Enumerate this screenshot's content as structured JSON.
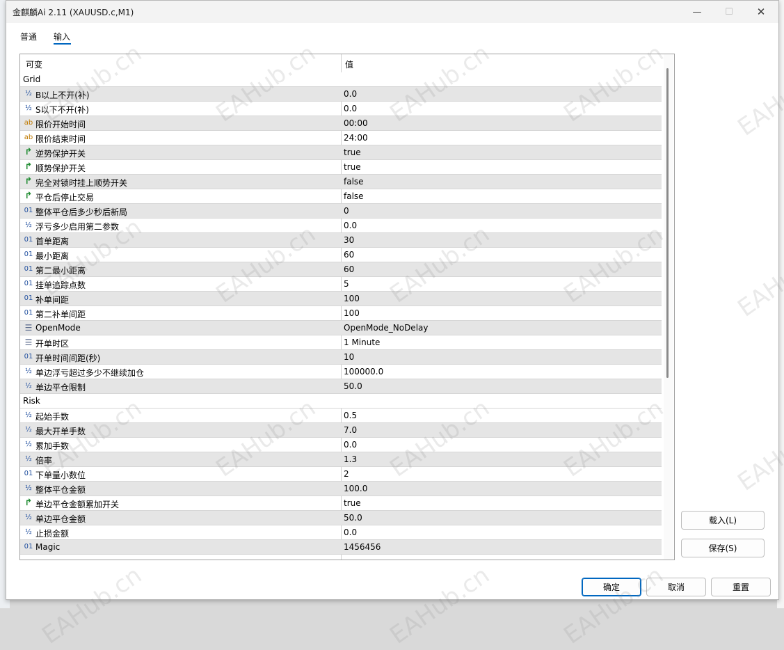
{
  "window": {
    "title": "金麒麟Ai 2.11 (XAUUSD.c,M1)",
    "min_icon": "—",
    "max_icon": "☐",
    "close_icon": "✕"
  },
  "tabs": [
    {
      "label": "普通"
    },
    {
      "label": "输入"
    }
  ],
  "grid": {
    "col_variable": "可变",
    "col_value": "值",
    "rows": [
      {
        "type": "group",
        "name": "Grid",
        "value": ""
      },
      {
        "type": "double",
        "icon": "½",
        "name": "B以上不开(补)",
        "value": "0.0"
      },
      {
        "type": "double",
        "icon": "½",
        "name": "S以下不开(补)",
        "value": "0.0"
      },
      {
        "type": "string",
        "icon": "ab",
        "name": "限价开始时间",
        "value": "00:00"
      },
      {
        "type": "string",
        "icon": "ab",
        "name": "限价结束时间",
        "value": "24:00"
      },
      {
        "type": "bool",
        "icon": "↱",
        "name": "逆势保护开关",
        "value": "true"
      },
      {
        "type": "bool",
        "icon": "↱",
        "name": "顺势保护开关",
        "value": "true"
      },
      {
        "type": "bool",
        "icon": "↱",
        "name": "完全对锁时挂上顺势开关",
        "value": "false"
      },
      {
        "type": "bool",
        "icon": "↱",
        "name": "平仓后停止交易",
        "value": "false"
      },
      {
        "type": "int",
        "icon": "01",
        "name": "整体平仓后多少秒后新局",
        "value": "0"
      },
      {
        "type": "double",
        "icon": "½",
        "name": "浮亏多少启用第二参数",
        "value": "0.0"
      },
      {
        "type": "int",
        "icon": "01",
        "name": "首单距离",
        "value": "30"
      },
      {
        "type": "int",
        "icon": "01",
        "name": "最小距离",
        "value": "60"
      },
      {
        "type": "int",
        "icon": "01",
        "name": "第二最小距离",
        "value": "60"
      },
      {
        "type": "int",
        "icon": "01",
        "name": "挂单追踪点数",
        "value": "5"
      },
      {
        "type": "int",
        "icon": "01",
        "name": "补单间距",
        "value": "100"
      },
      {
        "type": "int",
        "icon": "01",
        "name": "第二补单间距",
        "value": "100"
      },
      {
        "type": "enum",
        "icon": "☰",
        "name": "OpenMode",
        "value": "OpenMode_NoDelay"
      },
      {
        "type": "enum",
        "icon": "☰",
        "name": "开单时区",
        "value": "1 Minute"
      },
      {
        "type": "int",
        "icon": "01",
        "name": "开单时间间距(秒)",
        "value": "10"
      },
      {
        "type": "double",
        "icon": "½",
        "name": "单边浮亏超过多少不继续加仓",
        "value": "100000.0"
      },
      {
        "type": "double",
        "icon": "½",
        "name": "单边平仓限制",
        "value": "50.0"
      },
      {
        "type": "group",
        "name": "Risk",
        "value": ""
      },
      {
        "type": "double",
        "icon": "½",
        "name": "起始手数",
        "value": "0.5"
      },
      {
        "type": "double",
        "icon": "½",
        "name": "最大开单手数",
        "value": "7.0"
      },
      {
        "type": "double",
        "icon": "½",
        "name": "累加手数",
        "value": "0.0"
      },
      {
        "type": "double",
        "icon": "½",
        "name": "倍率",
        "value": "1.3"
      },
      {
        "type": "int",
        "icon": "01",
        "name": "下单量小数位",
        "value": "2"
      },
      {
        "type": "double",
        "icon": "½",
        "name": "整体平仓金额",
        "value": "100.0"
      },
      {
        "type": "bool",
        "icon": "↱",
        "name": "单边平仓金额累加开关",
        "value": "true"
      },
      {
        "type": "double",
        "icon": "½",
        "name": "单边平仓金额",
        "value": "50.0"
      },
      {
        "type": "double",
        "icon": "½",
        "name": "止损金额",
        "value": "0.0"
      },
      {
        "type": "int",
        "icon": "01",
        "name": "Magic",
        "value": "1456456"
      }
    ]
  },
  "buttons": {
    "load": "载入(L)",
    "save": "保存(S)",
    "ok": "确定",
    "cancel": "取消",
    "reset": "重置"
  },
  "watermark": "EAHub.cn"
}
